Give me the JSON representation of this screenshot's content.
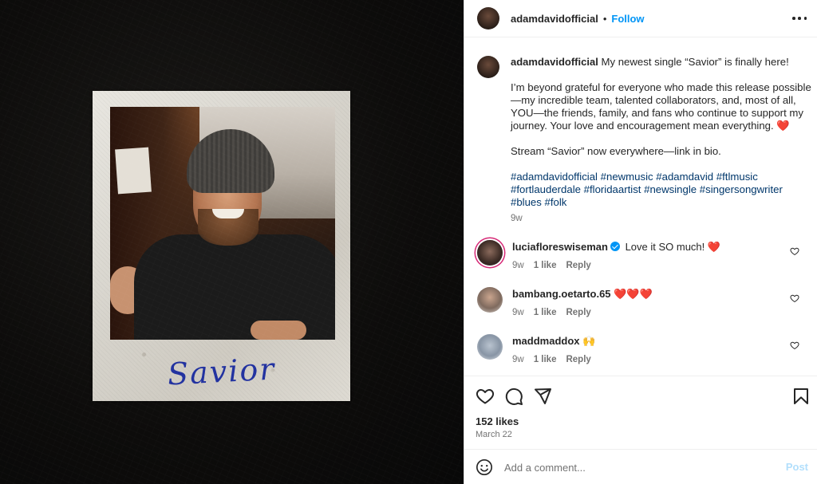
{
  "post": {
    "author": "adamdavidofficial",
    "follow_label": "Follow",
    "dot": "•",
    "image_caption": "Savior"
  },
  "caption": {
    "username": "adamdavidofficial",
    "line1": " My newest single “Savior” is finally here!",
    "paragraph2": "I’m beyond grateful for everyone who made this release possible—my incredible team, talented collaborators, and, most of all, YOU—the friends, family, and fans who continue to support my journey. Your love and encouragement mean everything. ",
    "paragraph3": "Stream “Savior” now everywhere—link in bio.",
    "hashtags": "#adamdavidofficial #newmusic #adamdavid #ftlmusic #fortlauderdale #floridaartist #newsingle #singersongwriter #blues #folk",
    "time": "9w",
    "heart": "❤️"
  },
  "comments": [
    {
      "username": "luciafloreswiseman",
      "text": " Love it SO much! ",
      "emoji": "❤️",
      "time": "9w",
      "likes": "1 like",
      "reply": "Reply"
    },
    {
      "username": "bambang.oetarto.65",
      "text": " ",
      "emoji": "❤️❤️❤️",
      "time": "9w",
      "likes": "1 like",
      "reply": "Reply"
    },
    {
      "username": "maddmaddox",
      "text": " ",
      "emoji": "🙌",
      "time": "9w",
      "likes": "1 like",
      "reply": "Reply"
    }
  ],
  "stats": {
    "likes": "152 likes",
    "date": "March 22"
  },
  "comment_box": {
    "placeholder": "Add a comment...",
    "post_label": "Post"
  },
  "icons": {
    "more": "more-options-icon",
    "like": "heart-icon",
    "comment": "comment-icon",
    "share": "send-icon",
    "save": "bookmark-icon",
    "emoji": "emoji-icon"
  }
}
